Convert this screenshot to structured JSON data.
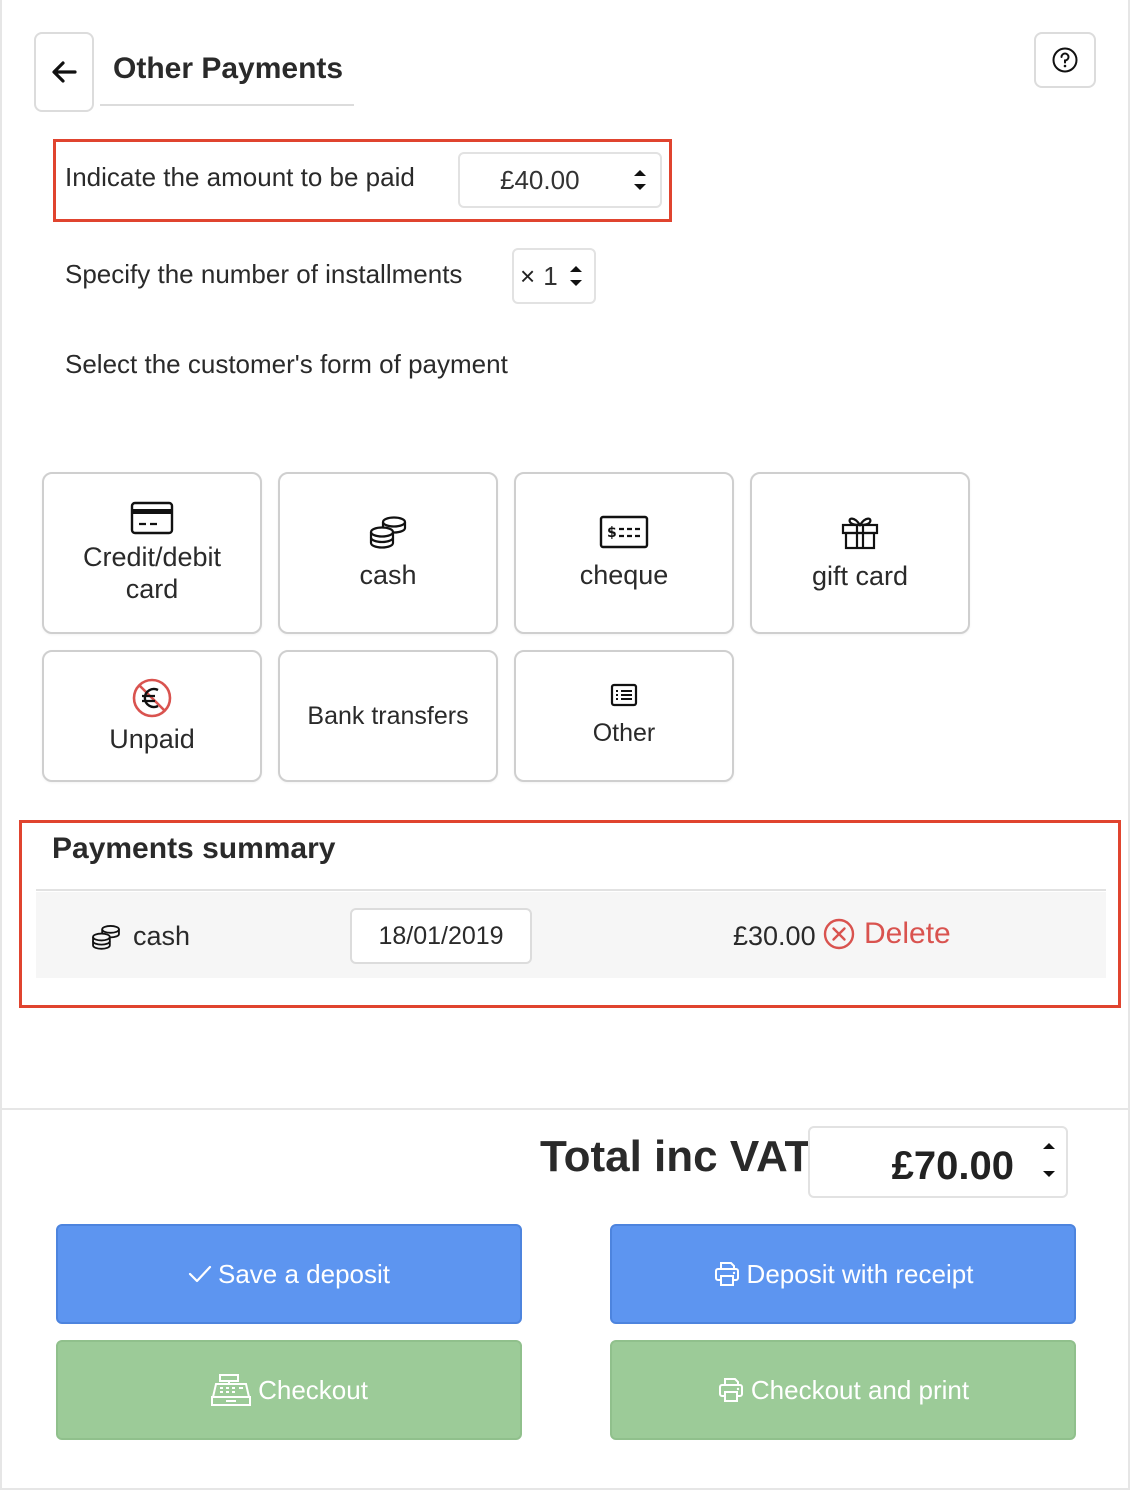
{
  "header": {
    "title": "Other Payments"
  },
  "amount": {
    "label": "Indicate the amount to be paid",
    "value": "£40.00"
  },
  "installments": {
    "label": "Specify the number of installments",
    "prefix": "×",
    "value": "1"
  },
  "payment_form": {
    "label": "Select the customer's form of payment",
    "methods": [
      {
        "label": "Credit/debit card",
        "icon": "credit-card-icon"
      },
      {
        "label": "cash",
        "icon": "coins-icon"
      },
      {
        "label": "cheque",
        "icon": "cheque-icon"
      },
      {
        "label": "gift card",
        "icon": "gift-icon"
      },
      {
        "label": "Unpaid",
        "icon": "no-euro-icon"
      },
      {
        "label": "Bank transfers",
        "icon": ""
      },
      {
        "label": "Other",
        "icon": "list-icon"
      }
    ]
  },
  "summary": {
    "title": "Payments summary",
    "rows": [
      {
        "method": "cash",
        "date": "18/01/2019",
        "amount": "£30.00",
        "delete_label": "Delete"
      }
    ]
  },
  "total": {
    "label": "Total inc VAT",
    "value": "£70.00"
  },
  "actions": {
    "save_deposit": "Save a deposit",
    "deposit_receipt": "Deposit with receipt",
    "checkout": "Checkout",
    "checkout_print": "Checkout and print"
  },
  "colors": {
    "highlight": "#e0442f",
    "primary": "#5d95f0",
    "success": "#9ccb98",
    "danger": "#d9534f"
  }
}
